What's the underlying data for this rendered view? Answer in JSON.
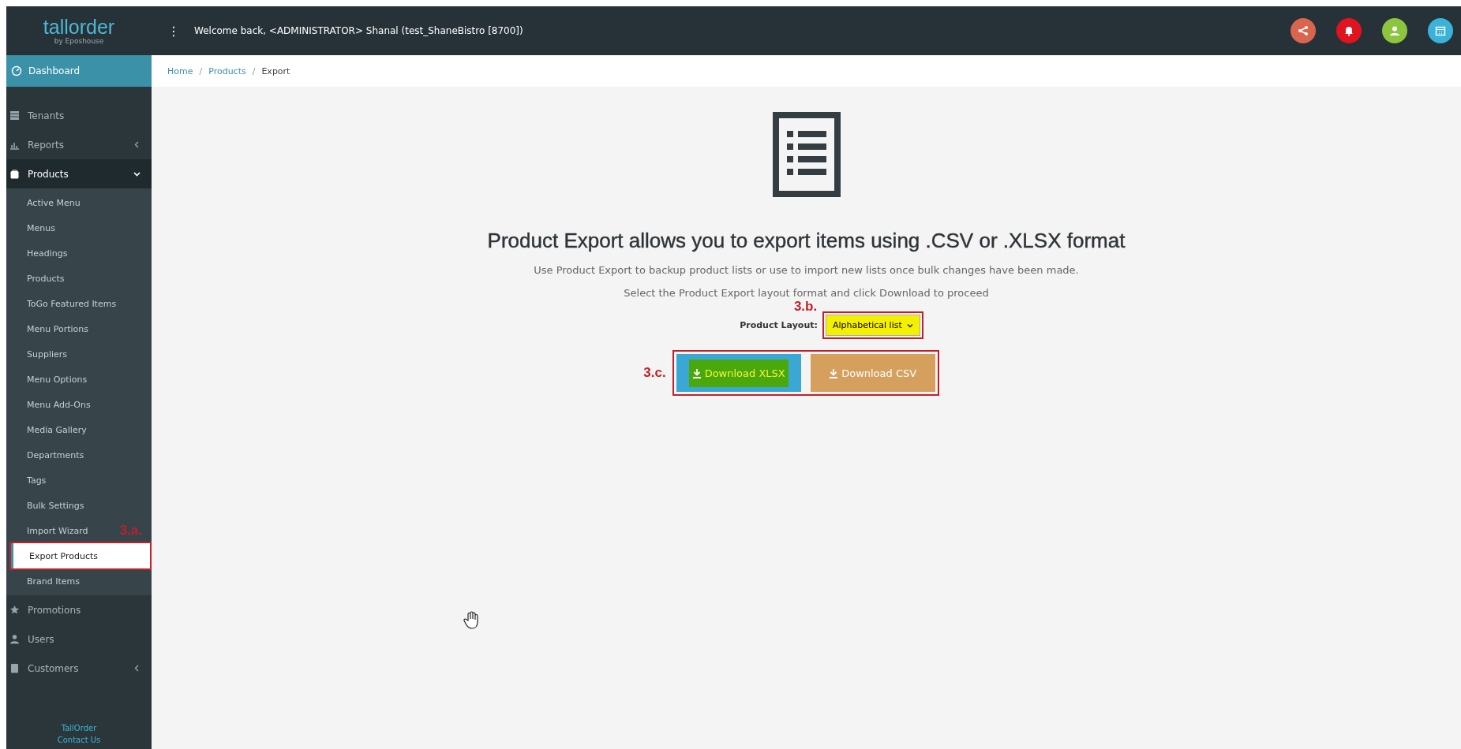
{
  "header": {
    "logo": "tallorder",
    "logo_sub": "by Eposhouse",
    "menu_glyph": "⋮",
    "welcome": "Welcome back, <ADMINISTRATOR> Shanal (test_ShaneBistro [8700])",
    "icons": [
      {
        "kind": "share",
        "color": "#d9654f"
      },
      {
        "kind": "bell",
        "color": "#e0141e"
      },
      {
        "kind": "user",
        "color": "#8cc63f"
      },
      {
        "kind": "calendar",
        "color": "#3bb3d8"
      }
    ]
  },
  "sidebar": {
    "dashboard": {
      "label": "Dashboard",
      "selected": true
    },
    "items": [
      {
        "label": "Tenants",
        "kind": "table",
        "expanded": false,
        "has_children": false,
        "selected": false
      },
      {
        "label": "Reports",
        "kind": "chart",
        "expanded": false,
        "has_children": true,
        "selected": false
      },
      {
        "label": "Products",
        "kind": "bag",
        "expanded": true,
        "has_children": true,
        "selected": false,
        "children": [
          {
            "label": "Active Menu",
            "selected": false
          },
          {
            "label": "Menus",
            "selected": false
          },
          {
            "label": "Headings",
            "selected": false
          },
          {
            "label": "Products",
            "selected": false
          },
          {
            "label": "ToGo Featured Items",
            "selected": false
          },
          {
            "label": "Menu Portions",
            "selected": false
          },
          {
            "label": "Suppliers",
            "selected": false
          },
          {
            "label": "Menu Options",
            "selected": false
          },
          {
            "label": "Menu Add-Ons",
            "selected": false
          },
          {
            "label": "Media Gallery",
            "selected": false
          },
          {
            "label": "Departments",
            "selected": false
          },
          {
            "label": "Tags",
            "selected": false
          },
          {
            "label": "Bulk Settings",
            "selected": false
          },
          {
            "label": "Import Wizard",
            "selected": false
          },
          {
            "label": "Export Products",
            "selected": true,
            "annotation": "3.a."
          },
          {
            "label": "Brand Items",
            "selected": false
          }
        ]
      },
      {
        "label": "Promotions",
        "kind": "star",
        "expanded": false,
        "has_children": false,
        "selected": false
      },
      {
        "label": "Users",
        "kind": "user",
        "expanded": false,
        "has_children": false,
        "selected": false
      },
      {
        "label": "Customers",
        "kind": "book",
        "expanded": false,
        "has_children": true,
        "selected": false
      }
    ],
    "footer": [
      "TallOrder",
      "Contact Us"
    ]
  },
  "breadcrumb": [
    {
      "label": "Home",
      "link": true
    },
    {
      "separator": "/",
      "label": "Products",
      "link": true
    },
    {
      "separator": "/",
      "label": "Export",
      "link": false
    }
  ],
  "content": {
    "heading": "Product Export allows you to export items using .CSV or .XLSX format",
    "lines": [
      "Use Product Export to backup product lists or use to import new lists once bulk changes have been made.",
      "Select the Product Export layout format and click Download to proceed"
    ],
    "layout": {
      "label": "Product Layout:",
      "value": "Alphabetical list",
      "annotation": "3.b.",
      "highlighted": true
    },
    "buttons_annotation": "3.c.",
    "buttons": [
      {
        "label": "Download XLSX",
        "kind": "info",
        "highlighted": true
      },
      {
        "label": "Download CSV",
        "kind": "warning",
        "highlighted": false
      }
    ]
  }
}
